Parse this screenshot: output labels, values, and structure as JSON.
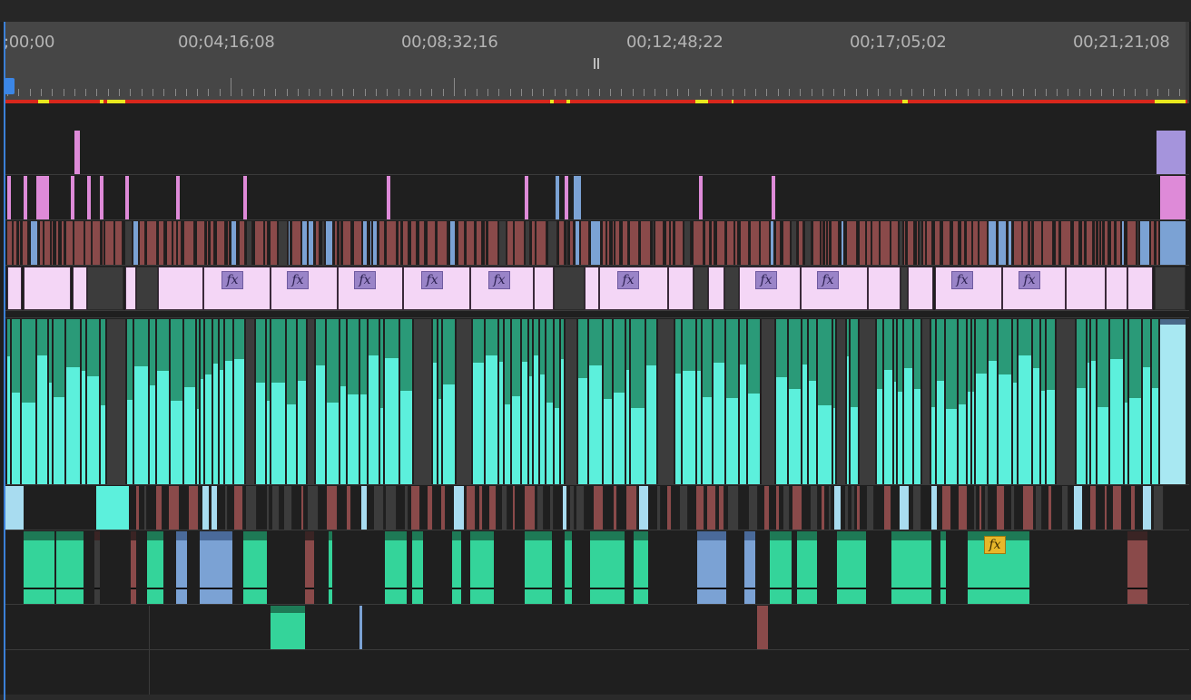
{
  "timeline": {
    "timecodes": [
      ";00;00",
      "00;04;16;08",
      "00;08;32;16",
      "00;12;48;22",
      "00;17;05;02",
      "00;21;21;08"
    ],
    "fx_label": "fx"
  },
  "colors": {
    "ruler_bg": "#464646",
    "track_bg": "#1f1f1f",
    "render_red": "#d8271c",
    "render_yellow": "#e8e81e",
    "playhead": "#3b7fd6",
    "clip_pink": "#de8ad8",
    "clip_lightpink": "#f4d6f6",
    "clip_maroon": "#8a4a4a",
    "clip_blue": "#7ba2d4",
    "clip_cyan": "#5cf0dc",
    "clip_teal": "#34d49a",
    "clip_gray": "#3c3c3c",
    "clip_lavender": "#a594dc"
  },
  "icons": {
    "playhead": "playhead-marker-icon",
    "pause": "pause-icon"
  }
}
